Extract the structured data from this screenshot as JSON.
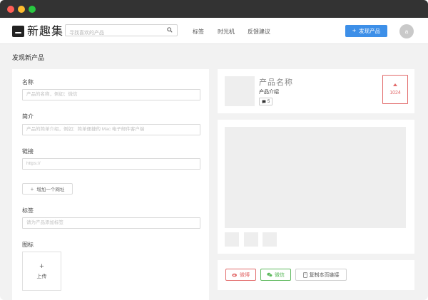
{
  "app": {
    "logo_text": "新趣集"
  },
  "navbar": {
    "search_placeholder": "寻找喜欢的产品",
    "nav_items": [
      "标签",
      "时光机",
      "反馈建议"
    ],
    "discover_button": "发现产品",
    "avatar_letter": "a"
  },
  "page": {
    "title": "发现新产品"
  },
  "form": {
    "name_label": "名称",
    "name_placeholder": "产品的名称，例如：微信",
    "intro_label": "简介",
    "intro_placeholder": "产品的简单介绍，例如：简单便捷的 Mac 电子邮件客户端",
    "link_label": "链接",
    "link_placeholder": "https://",
    "add_url_button": "增加一个网址",
    "tags_label": "标签",
    "tags_placeholder": "请为产品添加标签",
    "icon_label": "图标",
    "upload_label": "上传"
  },
  "preview": {
    "product_name": "产品名称",
    "product_intro": "产品介绍",
    "comment_count": "5",
    "vote_count": "1024"
  },
  "share": {
    "weibo": "微博",
    "wechat": "微信",
    "copy_link": "复制本页链接"
  },
  "colors": {
    "accent": "#3d8fe8",
    "vote": "#e26a6a",
    "wechat": "#5cb85c",
    "titlebar": "#333333"
  }
}
